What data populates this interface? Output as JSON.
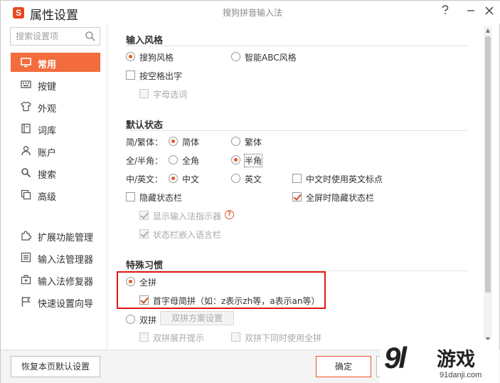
{
  "window": {
    "app_title": "属性设置",
    "title": "搜狗拼音输入法",
    "logo_letter": "S"
  },
  "search": {
    "placeholder": "搜索设置项"
  },
  "sidebar": {
    "items": [
      {
        "label": "常用",
        "icon": "monitor-icon",
        "active": true
      },
      {
        "label": "按键",
        "icon": "keyboard-icon"
      },
      {
        "label": "外观",
        "icon": "shirt-icon"
      },
      {
        "label": "词库",
        "icon": "book-icon"
      },
      {
        "label": "账户",
        "icon": "user-icon"
      },
      {
        "label": "搜索",
        "icon": "search-icon"
      },
      {
        "label": "高级",
        "icon": "layers-icon"
      }
    ],
    "tools": [
      {
        "label": "扩展功能管理",
        "icon": "puzzle-icon"
      },
      {
        "label": "输入法管理器",
        "icon": "list-icon"
      },
      {
        "label": "输入法修复器",
        "icon": "toolbox-icon"
      },
      {
        "label": "快速设置向导",
        "icon": "flag-icon"
      }
    ]
  },
  "sections": {
    "input_style": {
      "title": "输入风格",
      "sogou_style": "搜狗风格",
      "abc_style": "智能ABC风格",
      "space_output": "按空格出字",
      "letter_select": "字母选词"
    },
    "default_state": {
      "title": "默认状态",
      "simp_trad_label": "简/繁体：",
      "simplified": "简体",
      "traditional": "繁体",
      "width_label": "全/半角：",
      "full_width": "全角",
      "half_width": "半角",
      "lang_label": "中/英文：",
      "chinese": "中文",
      "english": "英文",
      "english_punct": "中文时使用英文标点",
      "hide_status": "隐藏状态栏",
      "fullscreen_hide": "全屏时隐藏状态栏",
      "show_indicator": "显示输入法指示器",
      "help_glyph": "?",
      "embed_lang_bar": "状态栏嵌入语言栏"
    },
    "habits": {
      "title": "特殊习惯",
      "full_pinyin": "全拼",
      "initials": "首字母简拼（如：z表示zh等，a表示an等）",
      "double_pinyin": "双拼",
      "scheme_button": "双拼方案设置",
      "double_expand": "双拼展开提示",
      "double_with_full": "双拼下同时使用全拼"
    }
  },
  "footer": {
    "restore": "恢复本页默认设置",
    "ok": "确定"
  },
  "watermark": {
    "logo": "9l",
    "text": "游戏",
    "sub": "91danji.com"
  },
  "colors": {
    "accent": "#f26c3d",
    "highlight_box": "#e01818"
  }
}
